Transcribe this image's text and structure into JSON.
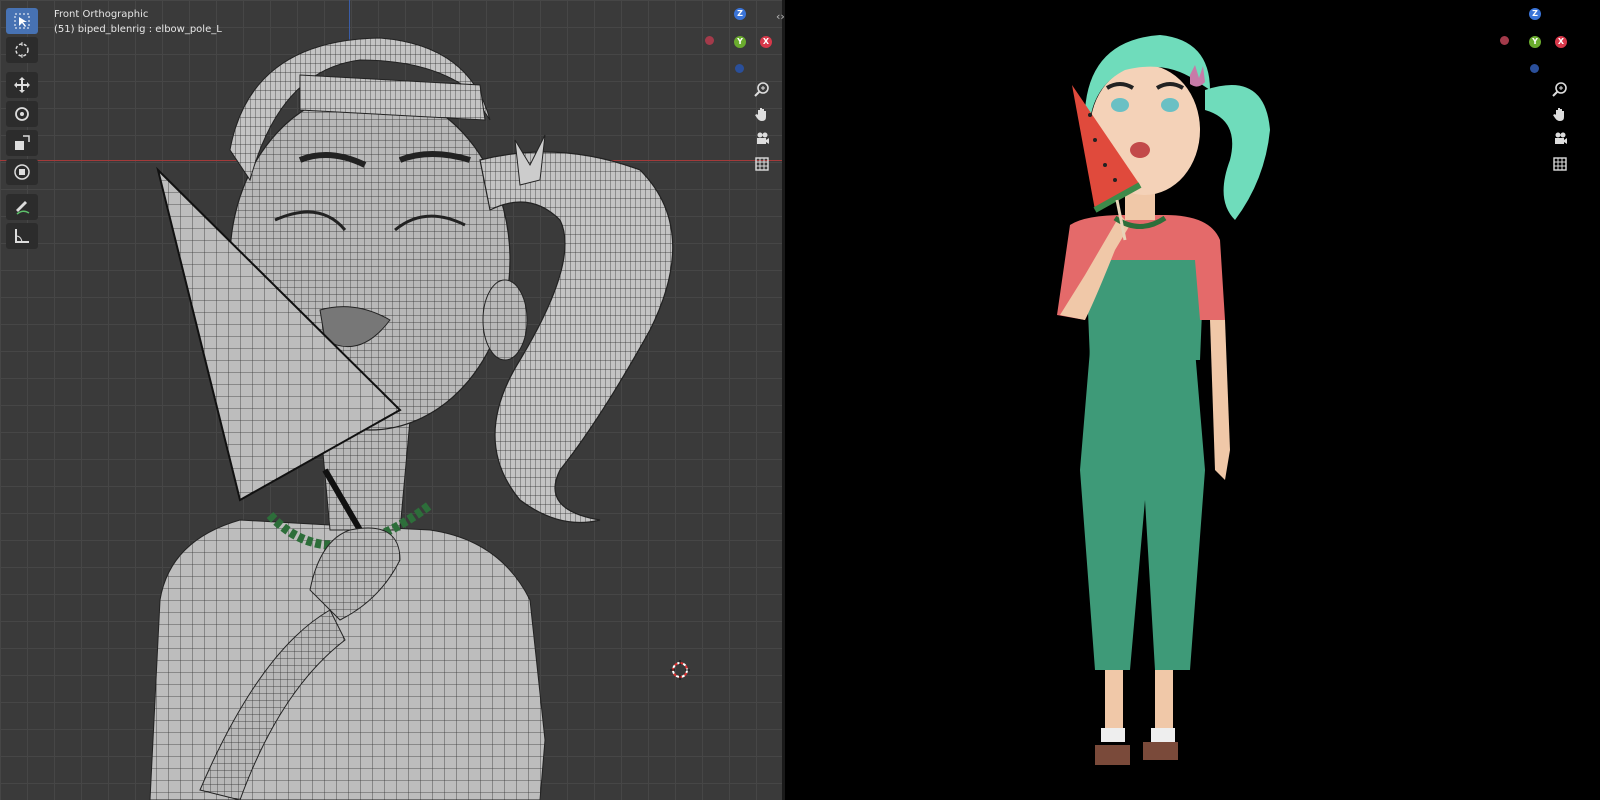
{
  "left_viewport": {
    "view_name": "Front Orthographic",
    "object_info": "(51) biped_blenrig : elbow_pole_L"
  },
  "gizmo": {
    "z_label": "Z",
    "y_label": "Y",
    "x_label": "X",
    "colors": {
      "z": "#3a74d8",
      "y": "#6aab2e",
      "x": "#d8384a",
      "neg_x": "#a33a4a",
      "neg_z": "#2a4f9a"
    }
  },
  "toolbar": {
    "tools": [
      "select-box-icon",
      "cursor-icon",
      "move-icon",
      "rotate-icon",
      "scale-icon",
      "transform-icon",
      "annotate-icon",
      "measure-icon"
    ]
  },
  "navigation": {
    "buttons": [
      "zoom-icon",
      "pan-hand-icon",
      "camera-icon",
      "grid-ortho-icon"
    ]
  },
  "colors": {
    "viewport_bg": "#3a3a3a",
    "render_bg": "#000000",
    "active_tool": "#4772b3",
    "hair": "#6fdcbb",
    "overalls": "#3e9a78",
    "shirt": "#e46a6a",
    "watermelon": "#e04a3c"
  }
}
